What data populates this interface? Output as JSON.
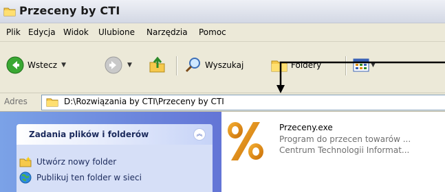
{
  "window": {
    "title": "Przeceny by CTI"
  },
  "menu": [
    "Plik",
    "Edycja",
    "Widok",
    "Ulubione",
    "Narzędzia",
    "Pomoc"
  ],
  "toolbar": {
    "back_label": "Wstecz",
    "search_label": "Wyszukaj",
    "folders_label": "Foldery"
  },
  "address": {
    "label": "Adres",
    "path": "D:\\Rozwiązania by CTI\\Przeceny by CTI"
  },
  "tasks": {
    "title": "Zadania plików i folderów",
    "items": [
      "Utwórz nowy folder",
      "Publikuj ten folder w sieci"
    ]
  },
  "file": {
    "name": "Przeceny.exe",
    "description": "Program do przecen towarów ...",
    "company": "Centrum Technologii Informat..."
  },
  "colors": {
    "task_pane": "#6f8ce0",
    "address_border": "#7f9db9"
  }
}
